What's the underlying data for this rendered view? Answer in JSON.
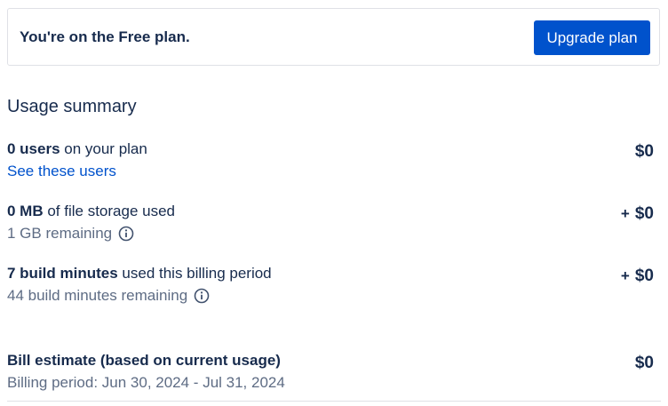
{
  "banner": {
    "text": "You're on the Free plan.",
    "button_label": "Upgrade plan"
  },
  "usage": {
    "title": "Usage summary",
    "users": {
      "bold": "0 users",
      "rest": " on your plan",
      "link": "See these users",
      "price": "$0"
    },
    "storage": {
      "bold": "0 MB",
      "rest": " of file storage used",
      "sub": "1 GB remaining",
      "plus": "+",
      "price": "$0"
    },
    "build": {
      "bold": "7 build minutes",
      "rest": " used this billing period",
      "sub": "44 build minutes remaining",
      "plus": "+",
      "price": "$0"
    }
  },
  "bill": {
    "title": "Bill estimate (based on current usage)",
    "period": "Billing period: Jun 30, 2024 - Jul 31, 2024",
    "price": "$0"
  },
  "colors": {
    "primary_button": "#0052cc",
    "text_primary": "#172b4d",
    "text_secondary": "#5e6c84",
    "link": "#0052cc",
    "border": "#dfe1e6"
  },
  "icons": {
    "info": "info-icon"
  }
}
